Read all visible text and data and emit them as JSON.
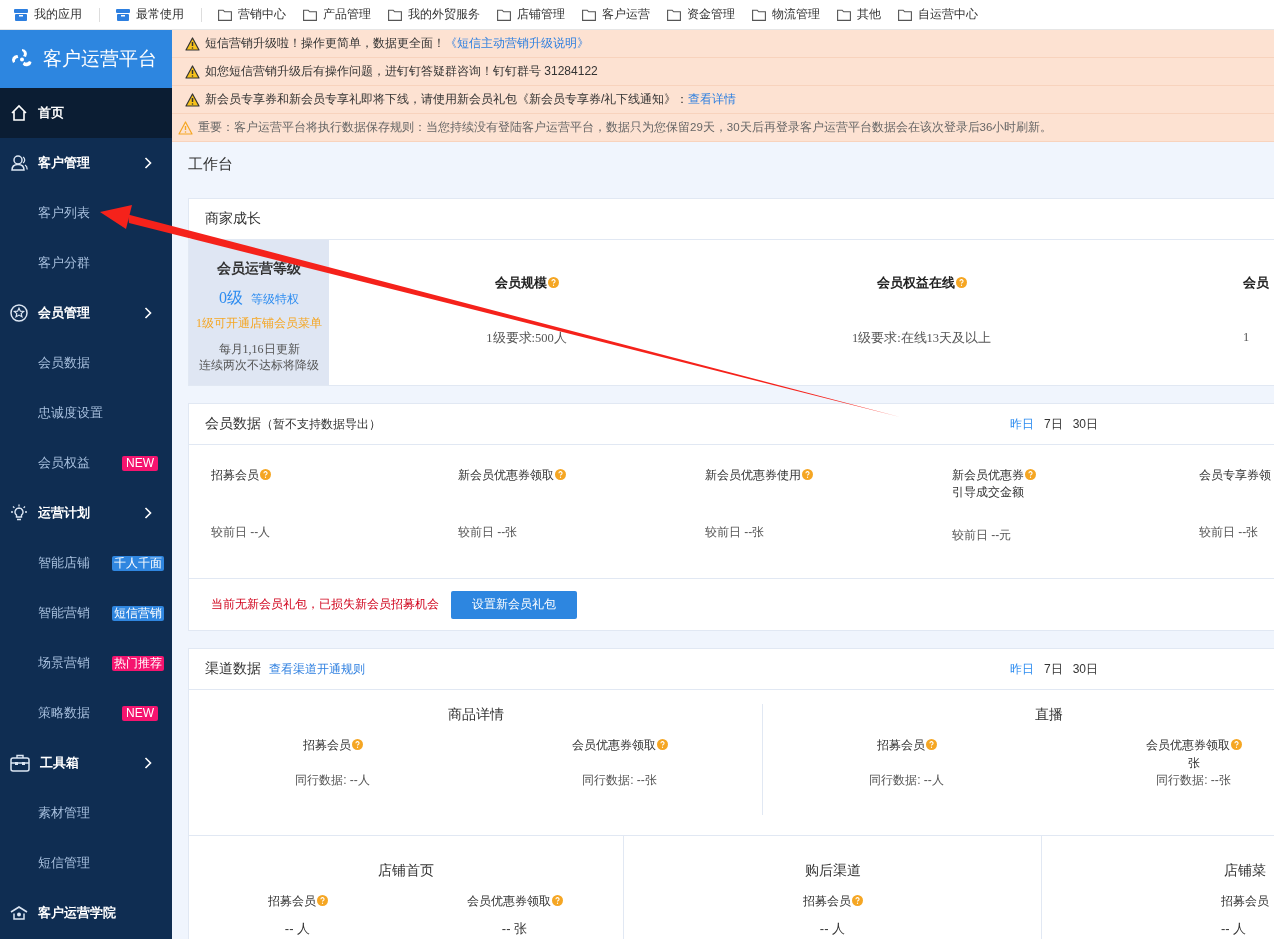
{
  "top_nav": [
    {
      "label": "我的应用",
      "kind": "app"
    },
    {
      "label": "最常使用",
      "kind": "app"
    },
    {
      "label": "营销中心",
      "kind": "folder"
    },
    {
      "label": "产品管理",
      "kind": "folder"
    },
    {
      "label": "我的外贸服务",
      "kind": "folder"
    },
    {
      "label": "店铺管理",
      "kind": "folder"
    },
    {
      "label": "客户运营",
      "kind": "folder"
    },
    {
      "label": "资金管理",
      "kind": "folder"
    },
    {
      "label": "物流管理",
      "kind": "folder"
    },
    {
      "label": "其他",
      "kind": "folder"
    },
    {
      "label": "自运营中心",
      "kind": "folder"
    }
  ],
  "sidebar": {
    "title": "客户运营平台",
    "items": [
      {
        "label": "首页",
        "kind": "home",
        "selected": true
      },
      {
        "label": "客户管理",
        "kind": "user",
        "selected": false,
        "children": [
          {
            "label": "客户列表",
            "selected": false
          },
          {
            "label": "客户分群",
            "selected": false
          }
        ]
      },
      {
        "label": "会员管理",
        "kind": "star",
        "selected": false,
        "children": [
          {
            "label": "会员数据",
            "selected": false
          },
          {
            "label": "忠诚度设置",
            "selected": false
          },
          {
            "label": "会员权益",
            "selected": false,
            "badge": {
              "text": "NEW",
              "color": "#f5146f"
            }
          }
        ]
      },
      {
        "label": "运营计划",
        "kind": "bulb",
        "selected": false,
        "children": [
          {
            "label": "智能店铺",
            "selected": false,
            "badge": {
              "text": "千人千面",
              "color": "#2f86e0"
            }
          },
          {
            "label": "智能营销",
            "selected": false,
            "badge": {
              "text": "短信营销",
              "color": "#2f86e0"
            }
          },
          {
            "label": "场景营销",
            "selected": false,
            "badge": {
              "text": "热门推荐",
              "color": "#f5146f"
            }
          },
          {
            "label": "策略数据",
            "selected": false,
            "badge": {
              "text": "NEW",
              "color": "#f5146f"
            }
          }
        ]
      },
      {
        "label": "工具箱",
        "kind": "toolbox",
        "selected": false,
        "children": [
          {
            "label": "素材管理",
            "selected": false
          },
          {
            "label": "短信管理",
            "selected": false
          }
        ]
      },
      {
        "label": "客户运营学院",
        "kind": "academy",
        "selected": false
      }
    ]
  },
  "notices": [
    {
      "kind": "warning",
      "text": "短信营销升级啦！操作更简单，数据更全面！",
      "link": "《短信主动营销升级说明》"
    },
    {
      "kind": "warning",
      "text": "如您短信营销升级后有操作问题，进钉钉答疑群咨询！钉钉群号 31284122"
    },
    {
      "kind": "warning",
      "text": "新会员专享券和新会员专享礼即将下线，请使用新会员礼包《新会员专享券/礼下线通知》：",
      "link": "查看详情"
    },
    {
      "kind": "important",
      "text": "重要：客户运营平台将执行数据保存规则：当您持续没有登陆客户运营平台，数据只为您保留29天，30天后再登录客户运营平台数据会在该次登录后36小时刷新。"
    }
  ],
  "page_title": "工作台",
  "growth": {
    "title": "商家成长",
    "level_panel": {
      "title": "会员运营等级",
      "level": "0级",
      "link": "等级特权",
      "hint": "1级可开通店铺会员菜单",
      "notes": [
        "每月1,16日更新",
        "连续两次不达标将降级"
      ]
    },
    "metrics": [
      {
        "label": "会员规模",
        "requirement": "1级要求:500人",
        "help": true
      },
      {
        "label": "会员权益在线",
        "requirement": "1级要求:在线13天及以上",
        "help": true
      },
      {
        "label": "会员",
        "requirement": "1",
        "help": false
      }
    ]
  },
  "member_data": {
    "title": "会员数据",
    "note": "（暂不支持数据导出）",
    "ranges": [
      {
        "label": "昨日",
        "selected": true
      },
      {
        "label": "7日",
        "selected": false
      },
      {
        "label": "30日",
        "selected": false
      }
    ],
    "metrics": [
      {
        "label": "招募会员",
        "compare": "较前日 --人",
        "help": true
      },
      {
        "label": "新会员优惠券领取",
        "compare": "较前日 --张",
        "help": true
      },
      {
        "label": "新会员优惠券使用",
        "compare": "较前日 --张",
        "help": true
      },
      {
        "label": "新会员优惠券",
        "sublabel": "引导成交金额",
        "compare": "较前日 --元",
        "help": true
      },
      {
        "label": "会员专享券领",
        "compare": "较前日 --张",
        "help": false
      }
    ],
    "alert": "当前无新会员礼包，已损失新会员招募机会",
    "button": "设置新会员礼包"
  },
  "channel_data": {
    "title": "渠道数据",
    "link": "查看渠道开通规则",
    "ranges": [
      {
        "label": "昨日",
        "selected": true
      },
      {
        "label": "7日",
        "selected": false
      },
      {
        "label": "30日",
        "selected": false
      }
    ],
    "row_1": [
      {
        "name": "商品详情",
        "metrics": [
          {
            "label": "招募会员",
            "peer": "同行数据: --人"
          },
          {
            "label": "会员优惠券领取",
            "peer": "同行数据: --张"
          }
        ]
      },
      {
        "name": "直播",
        "metrics": [
          {
            "label": "招募会员",
            "peer": "同行数据: --人"
          },
          {
            "label": "会员优惠券领取",
            "value": "张",
            "peer": "同行数据: --张"
          }
        ]
      }
    ],
    "row_2": [
      {
        "name": "店铺首页",
        "metrics": [
          {
            "label": "招募会员",
            "value": "-- 人",
            "help": true
          },
          {
            "label": "会员优惠券领取",
            "value": "-- 张",
            "help": true
          }
        ]
      },
      {
        "name": "购后渠道",
        "metrics": [
          {
            "label": "招募会员",
            "value": "-- 人",
            "help": true
          }
        ]
      },
      {
        "name": "店铺菜",
        "metrics": [
          {
            "label": "招募会员",
            "value": "-- 人",
            "help": false
          }
        ]
      }
    ]
  }
}
